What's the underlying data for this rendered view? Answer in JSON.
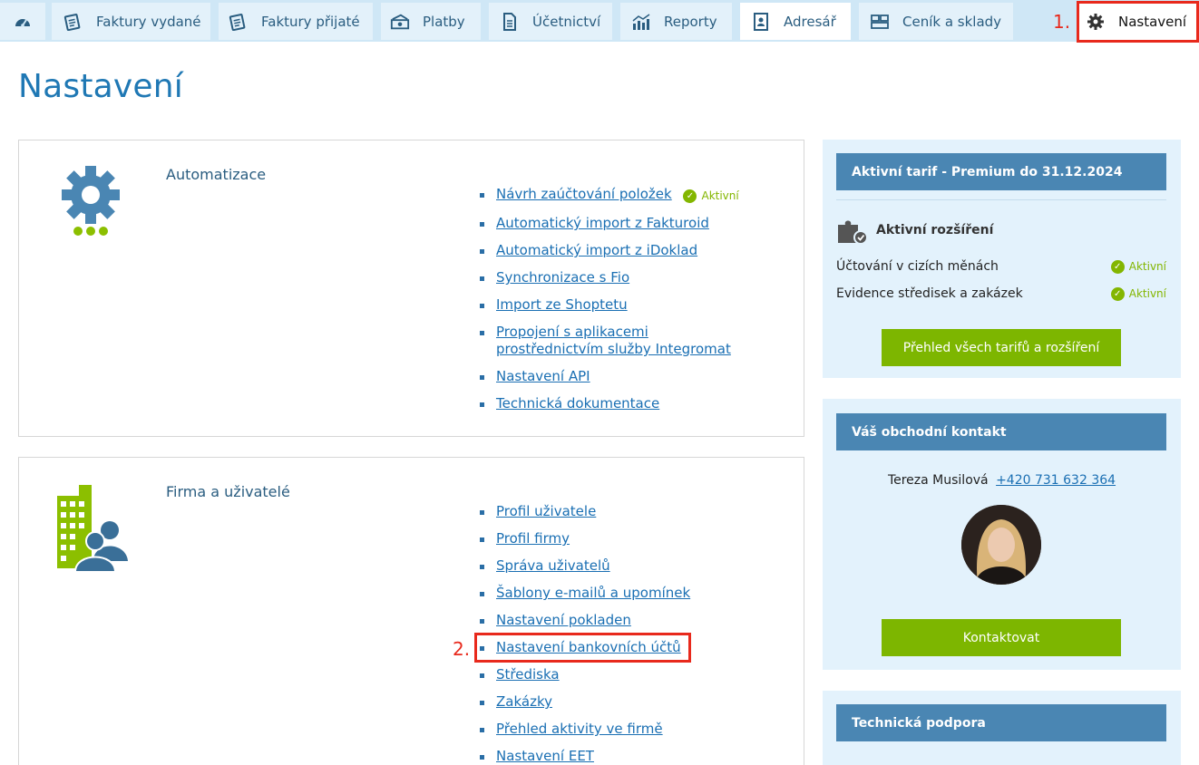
{
  "nav": {
    "tabs": [
      {
        "label": "Faktury vydané",
        "icon": "invoice-out-icon"
      },
      {
        "label": "Faktury přijaté",
        "icon": "invoice-in-icon"
      },
      {
        "label": "Platby",
        "icon": "payments-icon"
      },
      {
        "label": "Účetnictví",
        "icon": "accounting-icon"
      },
      {
        "label": "Reporty",
        "icon": "reports-icon"
      },
      {
        "label": "Adresář",
        "icon": "address-book-icon"
      },
      {
        "label": "Ceník a sklady",
        "icon": "warehouse-icon"
      }
    ],
    "settings_label": "Nastavení",
    "annotation_1": "1."
  },
  "page": {
    "title": "Nastavení"
  },
  "automation": {
    "title": "Automatizace",
    "links": [
      "Návrh zaúčtování položek",
      "Automatický import z Fakturoid",
      "Automatický import z iDoklad",
      "Synchronizace s Fio",
      "Import ze Shoptetu",
      "Propojení s aplikacemi prostřednictvím služby Integromat",
      "Nastavení API",
      "Technická dokumentace"
    ],
    "active_label": "Aktivní"
  },
  "company": {
    "title": "Firma a uživatelé",
    "links": [
      "Profil uživatele",
      "Profil firmy",
      "Správa uživatelů",
      "Šablony e-mailů a upomínek",
      "Nastavení pokladen",
      "Nastavení bankovních účtů",
      "Střediska",
      "Zakázky",
      "Přehled aktivity ve firmě",
      "Nastavení EET"
    ],
    "annotation_2": "2."
  },
  "tariff": {
    "head": "Aktivní tarif - Premium do 31.12.2024",
    "ext_title": "Aktivní rozšíření",
    "extensions": [
      {
        "name": "Účtování v cizích měnách",
        "status": "Aktivní"
      },
      {
        "name": "Evidence středisek a zakázek",
        "status": "Aktivní"
      }
    ],
    "button": "Přehled všech tarifů a rozšíření"
  },
  "contact": {
    "head": "Váš obchodní kontakt",
    "name": "Tereza Musilová",
    "phone": "+420 731 632 364",
    "button": "Kontaktovat"
  },
  "support": {
    "head": "Technická podpora"
  },
  "colors": {
    "accent": "#1f78b4",
    "green": "#7db600",
    "panel_head": "#4a86b3",
    "highlight": "#e8291c"
  }
}
